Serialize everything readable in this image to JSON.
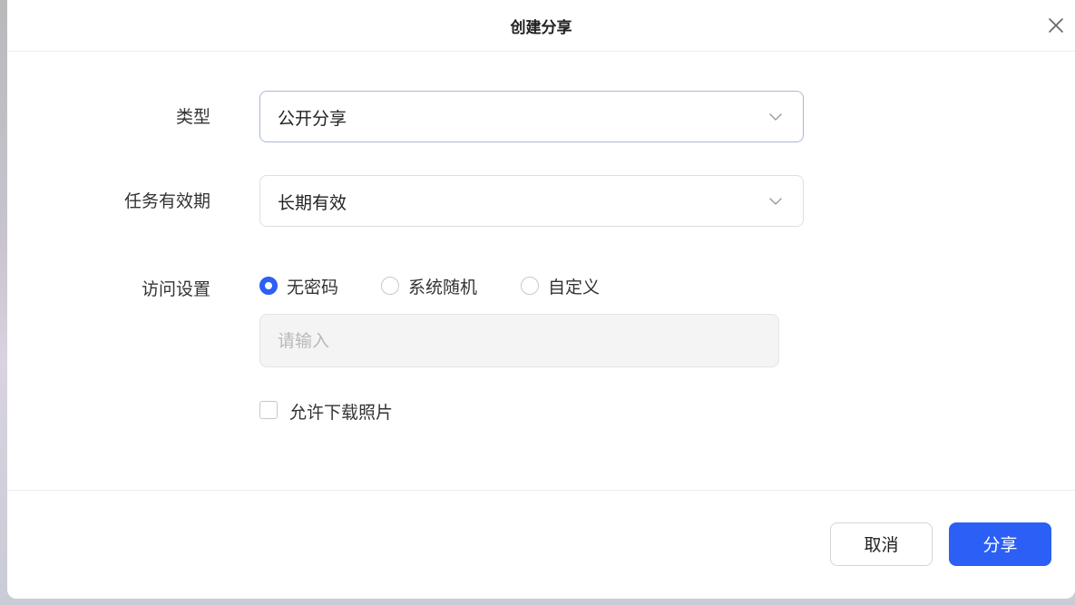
{
  "dialog": {
    "title": "创建分享",
    "close_icon": "close-icon"
  },
  "form": {
    "type": {
      "label": "类型",
      "value": "公开分享",
      "icon": "chevron-down-icon"
    },
    "validity": {
      "label": "任务有效期",
      "value": "长期有效",
      "icon": "chevron-down-icon"
    },
    "access": {
      "label": "访问设置",
      "options": [
        {
          "label": "无密码",
          "checked": true
        },
        {
          "label": "系统随机",
          "checked": false
        },
        {
          "label": "自定义",
          "checked": false
        }
      ],
      "password_placeholder": "请输入",
      "password_value": ""
    },
    "allow_download": {
      "label": "允许下载照片",
      "checked": false
    }
  },
  "footer": {
    "cancel_label": "取消",
    "submit_label": "分享"
  },
  "colors": {
    "primary": "#2b5ff5",
    "border": "#dcdfe6",
    "disabled_bg": "#f4f4f5"
  }
}
